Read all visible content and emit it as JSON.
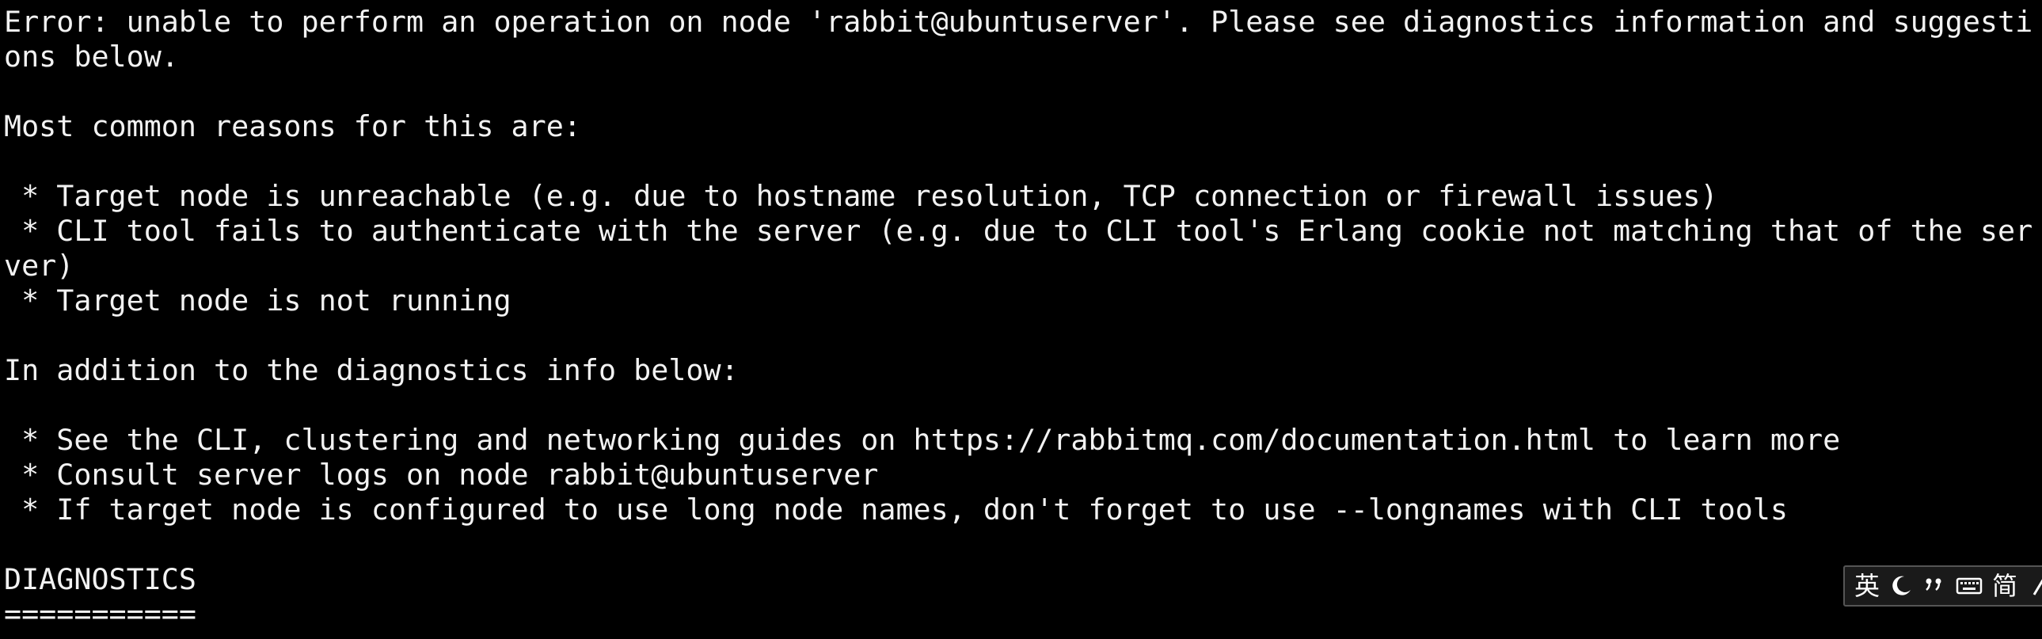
{
  "terminal": {
    "clipped_top_line": "",
    "lines": [
      "Error: unable to perform an operation on node 'rabbit@ubuntuserver'. Please see diagnostics information and suggesti",
      "ons below.",
      "",
      "Most common reasons for this are:",
      "",
      " * Target node is unreachable (e.g. due to hostname resolution, TCP connection or firewall issues)",
      " * CLI tool fails to authenticate with the server (e.g. due to CLI tool's Erlang cookie not matching that of the ser",
      "ver)",
      " * Target node is not running",
      "",
      "In addition to the diagnostics info below:",
      "",
      " * See the CLI, clustering and networking guides on https://rabbitmq.com/documentation.html to learn more",
      " * Consult server logs on node rabbit@ubuntuserver",
      " * If target node is configured to use long node names, don't forget to use --longnames with CLI tools",
      "",
      "DIAGNOSTICS",
      "==========="
    ]
  },
  "ime_toolbar": {
    "language_label": "英",
    "moon_icon": "moon-icon",
    "punctuation_icon": "punctuation-icon",
    "keyboard_icon": "keyboard-icon",
    "script_label": "简",
    "settings_icon": "settings-icon"
  },
  "colors": {
    "background": "#000000",
    "foreground": "#f2f2f2"
  }
}
